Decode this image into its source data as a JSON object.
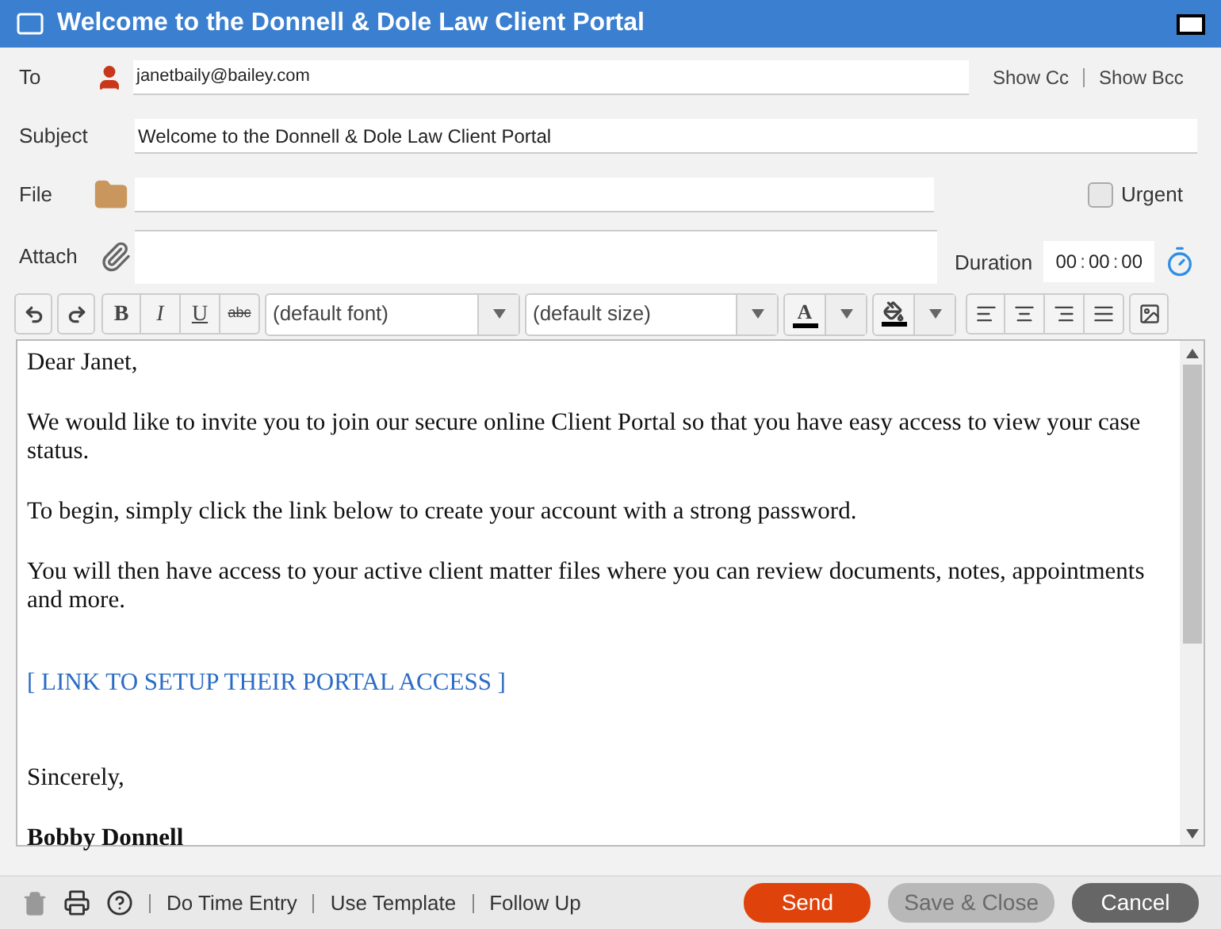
{
  "window": {
    "title": "Welcome to the Donnell & Dole Law Client Portal"
  },
  "fields": {
    "to_label": "To",
    "to_value": "janetbaily@bailey.com",
    "show_cc": "Show Cc",
    "show_bcc": "Show Bcc",
    "subject_label": "Subject",
    "subject_value": "Welcome to the Donnell & Dole Law Client Portal",
    "file_label": "File",
    "attach_label": "Attach",
    "urgent_label": "Urgent",
    "urgent_checked": false,
    "duration_label": "Duration",
    "duration_parts": [
      "00",
      "00",
      "00"
    ],
    "duration_separator": ":"
  },
  "toolbar": {
    "bold": "B",
    "italic": "I",
    "underline": "U",
    "strike": "abc",
    "font": "(default font)",
    "size": "(default size)",
    "font_color": "A"
  },
  "body": [
    {
      "kind": "text",
      "text": "Dear Janet,"
    },
    {
      "kind": "text",
      "text": "We would like to invite you to join our secure online Client Portal so that you have easy access to view your case status."
    },
    {
      "kind": "text",
      "text": "To begin, simply click the link below to create your account with a strong password."
    },
    {
      "kind": "text",
      "text": "You will then have access to your active client matter files where you can review documents, notes, appointments and more."
    },
    {
      "kind": "link",
      "text": "[ LINK TO SETUP THEIR PORTAL ACCESS ]"
    },
    {
      "kind": "text",
      "text": "Sincerely,"
    },
    {
      "kind": "signature",
      "text": "Bobby Donnell"
    }
  ],
  "footer": {
    "delete_disabled": true,
    "links": [
      "Do Time Entry",
      "Use Template",
      "Follow Up"
    ],
    "buttons": [
      {
        "label": "Send",
        "kind": "primary",
        "disabled": false
      },
      {
        "label": "Save & Close",
        "kind": "secondary",
        "disabled": true
      },
      {
        "label": "Cancel",
        "kind": "cancel",
        "disabled": false
      }
    ]
  }
}
